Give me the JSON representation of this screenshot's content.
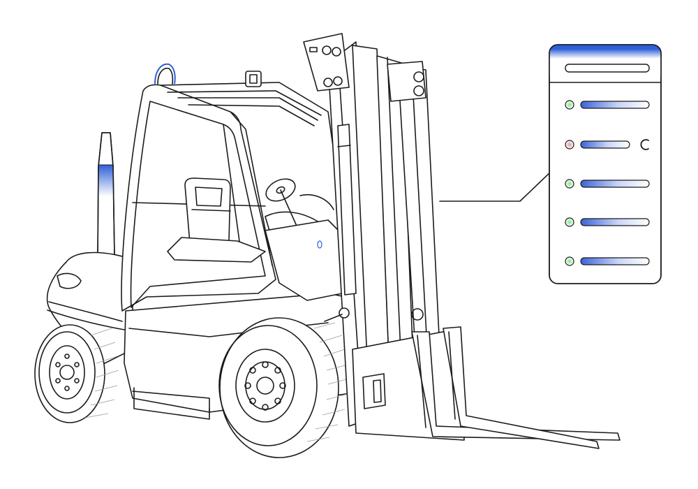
{
  "colors": {
    "accent": "#2f5fd6",
    "panel_border": "#1b1b1b",
    "status_ok": "#5fd36a",
    "status_warn": "#e9a3a3",
    "gradient_start": "#3a63d8",
    "gradient_end": "#ffffff"
  },
  "panel": {
    "rows": [
      {
        "status": "ok",
        "has_refresh": false
      },
      {
        "status": "warn",
        "has_refresh": true,
        "refresh_icon": "refresh-icon"
      },
      {
        "status": "ok",
        "has_refresh": false
      },
      {
        "status": "ok",
        "has_refresh": false
      },
      {
        "status": "ok",
        "has_refresh": false
      }
    ]
  },
  "icons": [
    "forklift-illustration",
    "status-dot",
    "refresh-icon",
    "beacon-light"
  ]
}
